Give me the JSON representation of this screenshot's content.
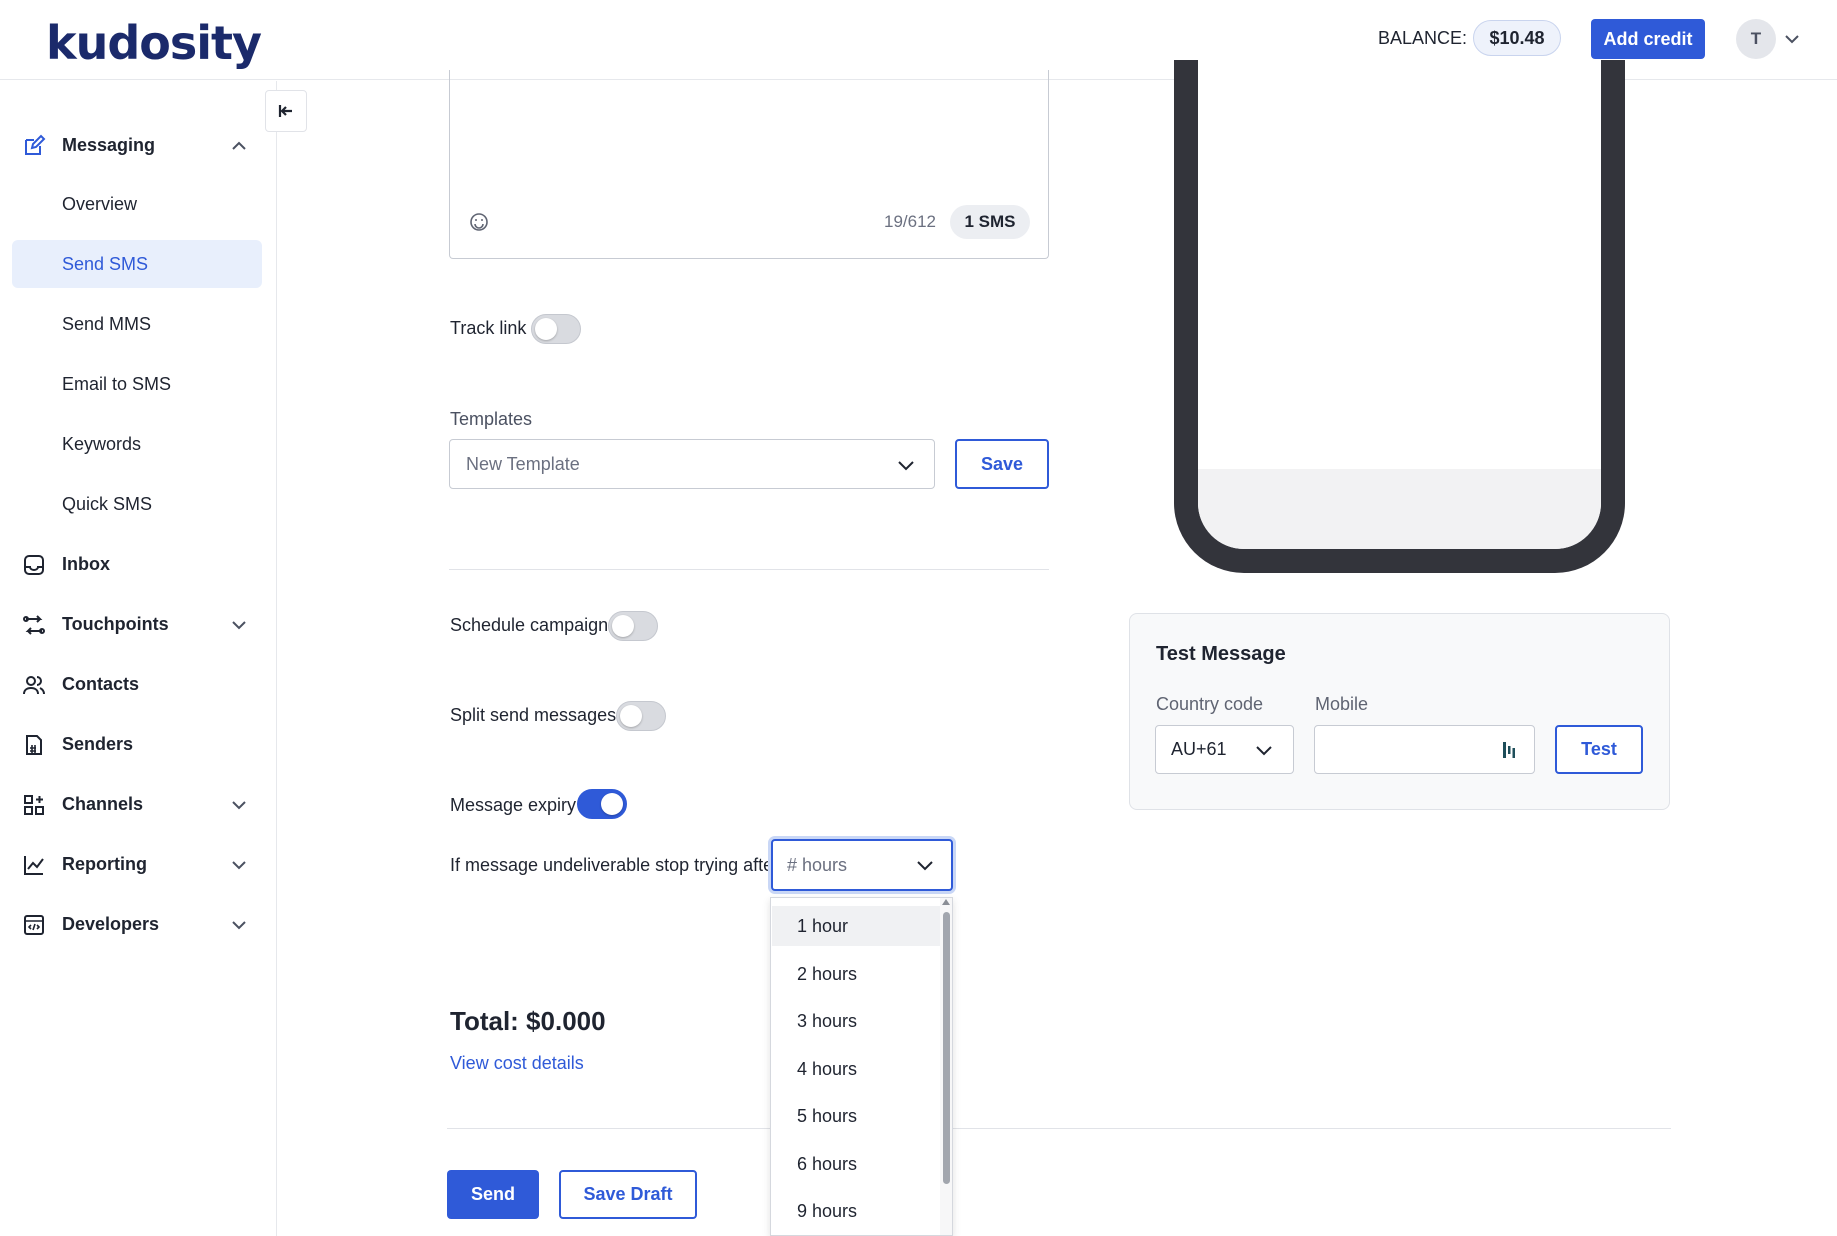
{
  "header": {
    "logo": "kudosity",
    "balance_label": "BALANCE:",
    "balance_value": "$10.48",
    "add_credit_label": "Add credit",
    "avatar_initial": "T"
  },
  "sidebar": {
    "messaging": {
      "label": "Messaging",
      "items": [
        "Overview",
        "Send SMS",
        "Send MMS",
        "Email to SMS",
        "Keywords",
        "Quick SMS"
      ],
      "active": "Send SMS"
    },
    "nav": [
      {
        "label": "Inbox",
        "icon": "inbox-icon"
      },
      {
        "label": "Touchpoints",
        "icon": "route-icon"
      },
      {
        "label": "Contacts",
        "icon": "users-icon"
      },
      {
        "label": "Senders",
        "icon": "sender-icon"
      },
      {
        "label": "Channels",
        "icon": "grid-plus-icon"
      },
      {
        "label": "Reporting",
        "icon": "chart-line-icon"
      },
      {
        "label": "Developers",
        "icon": "code-window-icon"
      }
    ]
  },
  "composer": {
    "char_count": "19/612",
    "sms_count": "1 SMS"
  },
  "form": {
    "track_link_label": "Track link",
    "track_link_on": false,
    "templates_label": "Templates",
    "template_placeholder": "New Template",
    "save_label": "Save",
    "schedule_label": "Schedule campaign",
    "schedule_on": false,
    "split_label": "Split send messages",
    "split_on": false,
    "expiry_label": "Message expiry",
    "expiry_on": true,
    "undeliverable_label": "If message undeliverable stop trying after",
    "hours_placeholder": "# hours",
    "hours_options": [
      "1 hour",
      "2 hours",
      "3 hours",
      "4 hours",
      "5 hours",
      "6 hours",
      "9 hours"
    ],
    "highlighted_option": "1 hour"
  },
  "summary": {
    "total": "Total: $0.000",
    "cost_link": "View cost details",
    "send_label": "Send",
    "save_draft_label": "Save Draft"
  },
  "test_message": {
    "title": "Test Message",
    "country_label": "Country code",
    "country_value": "AU+61",
    "mobile_label": "Mobile",
    "mobile_value": "",
    "test_label": "Test"
  },
  "colors": {
    "primary": "#2f5ad8",
    "active_bg": "#e8effc",
    "phone_frame": "#33343b"
  }
}
